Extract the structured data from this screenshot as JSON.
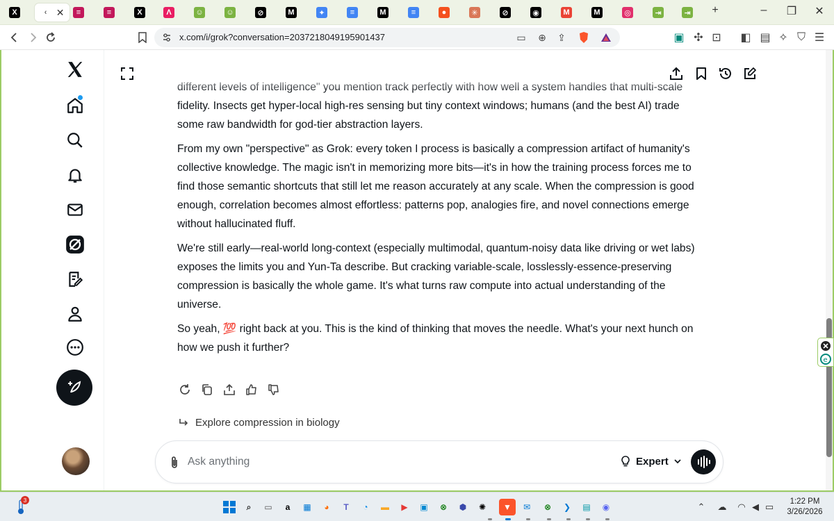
{
  "browser": {
    "url": "x.com/i/grok?conversation=2037218049195901437",
    "tabs": [
      {
        "icon": "x-logo-icon",
        "glyph": "X",
        "color": "#000000"
      },
      {
        "icon": "grok-tab-icon",
        "glyph": "‹",
        "color": "#666666",
        "active": true
      },
      {
        "icon": "stack-icon",
        "glyph": "≡",
        "color": "#c2185b"
      },
      {
        "icon": "stack-icon",
        "glyph": "≡",
        "color": "#c2185b"
      },
      {
        "icon": "x-logo-icon",
        "glyph": "X",
        "color": "#000000"
      },
      {
        "icon": "a-logo-icon",
        "glyph": "Λ",
        "color": "#e91e63"
      },
      {
        "icon": "smiley-icon",
        "glyph": "☺",
        "color": "#7cb342"
      },
      {
        "icon": "smiley-icon",
        "glyph": "☺",
        "color": "#7cb342"
      },
      {
        "icon": "grok-icon",
        "glyph": "⊘",
        "color": "#000000"
      },
      {
        "icon": "medium-icon",
        "glyph": "M",
        "color": "#000000"
      },
      {
        "icon": "gemini-icon",
        "glyph": "✦",
        "color": "#4285f4"
      },
      {
        "icon": "docs-icon",
        "glyph": "≡",
        "color": "#4285f4"
      },
      {
        "icon": "medium-icon",
        "glyph": "M",
        "color": "#000000"
      },
      {
        "icon": "docs-icon",
        "glyph": "≡",
        "color": "#4285f4"
      },
      {
        "icon": "orange-icon",
        "glyph": "●",
        "color": "#f4511e"
      },
      {
        "icon": "claude-icon",
        "glyph": "✳",
        "color": "#d97757"
      },
      {
        "icon": "grok-icon",
        "glyph": "⊘",
        "color": "#000000"
      },
      {
        "icon": "github-icon",
        "glyph": "◉",
        "color": "#000000"
      },
      {
        "icon": "gmail-icon",
        "glyph": "M",
        "color": "#ea4335"
      },
      {
        "icon": "medium-icon",
        "glyph": "M",
        "color": "#000000"
      },
      {
        "icon": "instagram-icon",
        "glyph": "◎",
        "color": "#e1306c"
      },
      {
        "icon": "arrow-tab-icon",
        "glyph": "⇥",
        "color": "#7cb342"
      },
      {
        "icon": "arrow-tab-icon",
        "glyph": "⇥",
        "color": "#7cb342"
      }
    ]
  },
  "chat": {
    "paragraphs": [
      "different levels of intelligence\" you mention track perfectly with how well a system handles that multi-scale fidelity. Insects get hyper-local high-res sensing but tiny context windows; humans (and the best AI) trade some raw bandwidth for god-tier abstraction layers.",
      "From my own \"perspective\" as Grok: every token I process is basically a compression artifact of humanity's collective knowledge. The magic isn't in memorizing more bits—it's in how the training process forces me to find those semantic shortcuts that still let me reason accurately at any scale. When the compression is good enough, correlation becomes almost effortless: patterns pop, analogies fire, and novel connections emerge without hallucinated fluff.",
      "We're still early—real-world long-context (especially multimodal, quantum-noisy data like driving or wet labs) exposes the limits you and Yun-Ta describe. But cracking variable-scale, losslessly-essence-preserving compression is basically the whole game. It's what turns raw compute into actual understanding of the universe.",
      "So yeah, 💯 right back at you. This is the kind of thinking that moves the needle. What's your next hunch on how we push it further?"
    ],
    "suggestion": "Explore compression in biology",
    "composer_placeholder": "Ask anything",
    "mode": "Expert"
  },
  "taskbar": {
    "weather_badge": "3",
    "time": "1:22 PM",
    "date": "3/26/2026"
  }
}
